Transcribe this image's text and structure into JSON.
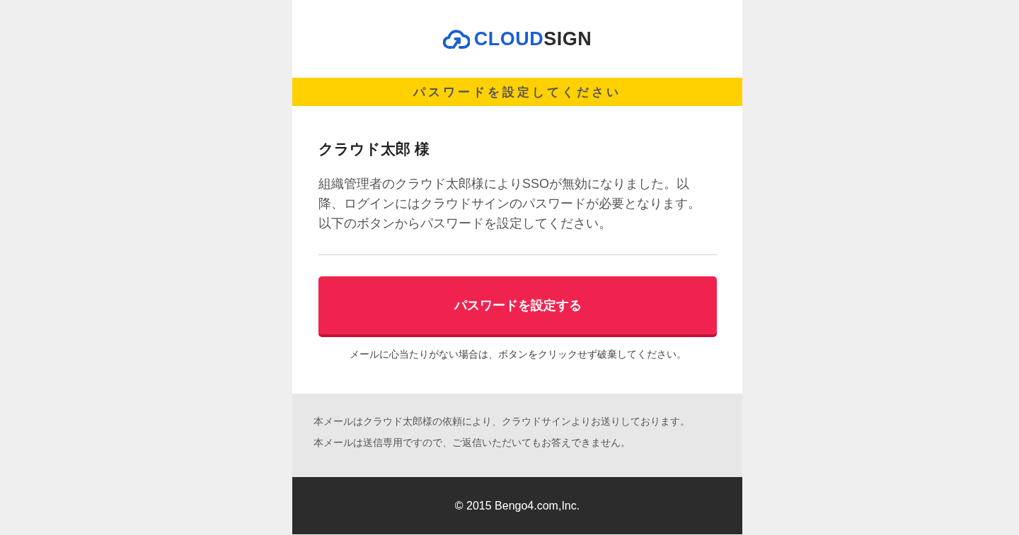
{
  "header": {
    "logo": {
      "primary": "CLOUD",
      "secondary": "SIGN"
    }
  },
  "banner": {
    "title": "パスワードを設定してください"
  },
  "message": {
    "greeting": "クラウド太郎 様",
    "body": "組織管理者のクラウド太郎様によりSSOが無効になりました。以降、ログインにはクラウドサインのパスワードが必要となります。以下のボタンからパスワードを設定してください。",
    "button": {
      "label": "パスワードを設定する"
    },
    "note": "メールに心当たりがない場合は、ボタンをクリックせず破棄してください。"
  },
  "notice": {
    "lines": [
      "本メールはクラウド太郎様の依頼により、クラウドサインよりお送りしております。",
      "本メールは送信専用ですので、ご返信いただいてもお答えできません。"
    ]
  },
  "footer": {
    "copyright": "© 2015 Bengo4.com,Inc."
  }
}
